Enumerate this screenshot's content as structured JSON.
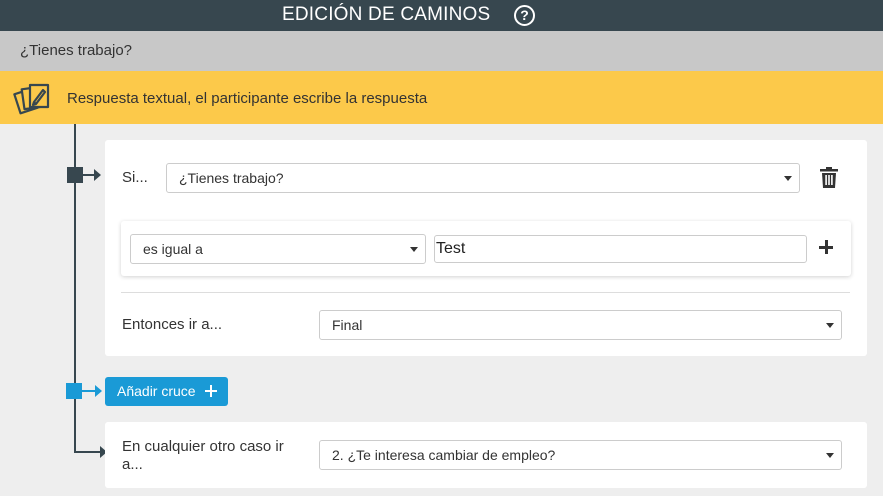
{
  "header": {
    "title": "EDICIÓN DE CAMINOS",
    "help_glyph": "?",
    "help_icon": "question-circle-icon"
  },
  "question": {
    "text": "¿Tienes trabajo?"
  },
  "question_type": {
    "icon": "text-cards-icon",
    "label": "Respuesta textual, el participante escribe la respuesta"
  },
  "rule": {
    "if_label": "Si...",
    "if_select_value": "¿Tienes trabajo?",
    "delete_icon": "trash-icon",
    "condition": {
      "operator_value": "es igual a",
      "value": "Test",
      "add_icon": "plus-icon"
    },
    "then_label": "Entonces ir a...",
    "then_select_value": "Final"
  },
  "add_crossing": {
    "label": "Añadir cruce",
    "icon": "plus-icon"
  },
  "otherwise": {
    "label_line1": "En cualquier otro caso ir",
    "label_line2": "a...",
    "select_value": "2. ¿Te interesa cambiar de empleo?"
  },
  "colors": {
    "header_bg": "#37474f",
    "question_bg": "#c8c8c8",
    "type_bg": "#fcc94a",
    "accent": "#1a9ad6",
    "page_bg": "#eeeeee"
  }
}
